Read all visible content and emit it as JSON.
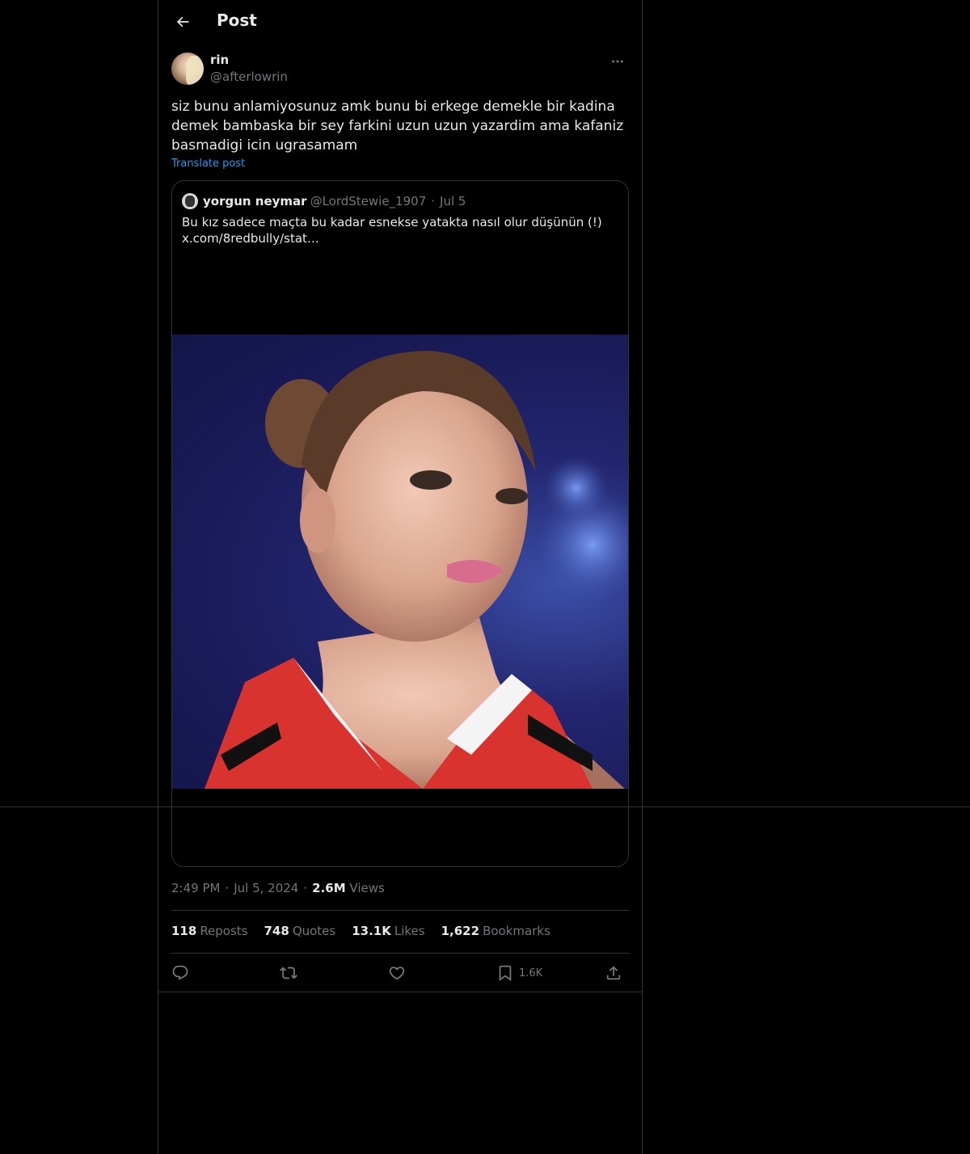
{
  "header": {
    "title": "Post"
  },
  "author": {
    "name": "rin",
    "handle": "@afterlowrin"
  },
  "post": {
    "text": "siz bunu anlamiyosunuz amk bunu bi erkege demekle bir kadina demek bambaska bir sey farkini uzun uzun yazardim ama kafaniz basmadigi icin ugrasamam",
    "translate_label": "Translate post"
  },
  "quote": {
    "name": "yorgun neymar",
    "handle": "@LordStewie_1907",
    "date": "Jul 5",
    "text_line1": "Bu kız sadece maçta bu kadar esnekse yatakta nasıl olur düşünün (!)",
    "text_line2": "x.com/8redbully/stat…"
  },
  "meta": {
    "time": "2:49 PM",
    "date": "Jul 5, 2024",
    "views_count": "2.6M",
    "views_label": "Views"
  },
  "stats": {
    "reposts_count": "118",
    "reposts_label": "Reposts",
    "quotes_count": "748",
    "quotes_label": "Quotes",
    "likes_count": "13.1K",
    "likes_label": "Likes",
    "bookmarks_count": "1,622",
    "bookmarks_label": "Bookmarks"
  },
  "actions": {
    "bookmark_count": "1.6K"
  },
  "colors": {
    "background": "#000000",
    "text": "#e7e9ea",
    "muted": "#71767b",
    "accent": "#1d9bf0",
    "border": "#2f3336"
  },
  "icons": [
    "back-arrow-icon",
    "more-icon",
    "reply-icon",
    "repost-icon",
    "like-icon",
    "bookmark-icon",
    "share-icon"
  ]
}
